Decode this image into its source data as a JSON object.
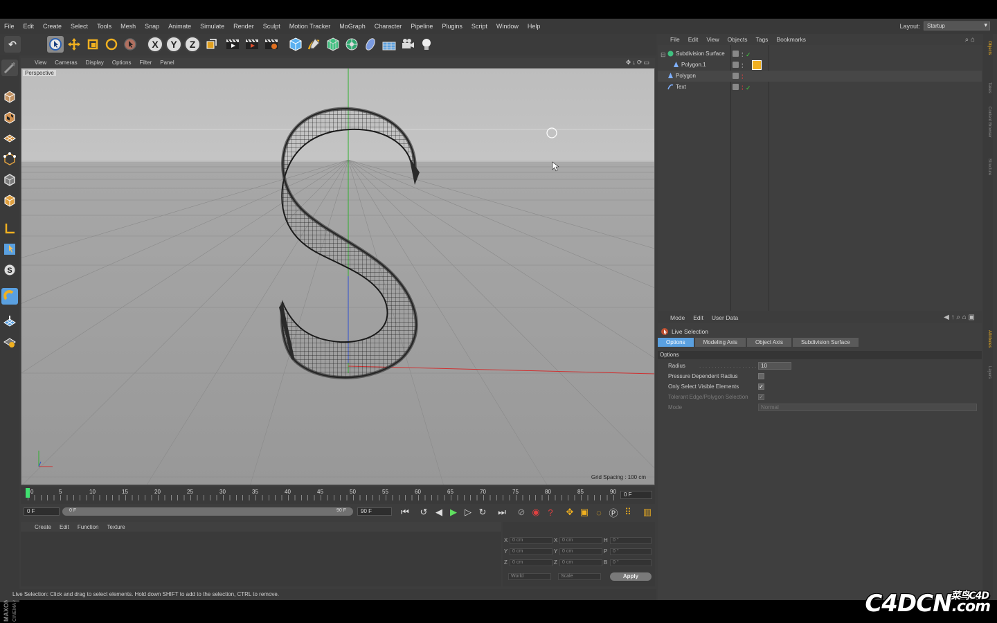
{
  "menubar": {
    "items": [
      "File",
      "Edit",
      "Create",
      "Select",
      "Tools",
      "Mesh",
      "Snap",
      "Animate",
      "Simulate",
      "Render",
      "Sculpt",
      "Motion Tracker",
      "MoGraph",
      "Character",
      "Pipeline",
      "Plugins",
      "Script",
      "Window",
      "Help"
    ],
    "layout_label": "Layout:",
    "layout_value": "Startup"
  },
  "toolbar": {
    "axis_x": "X",
    "axis_y": "Y",
    "axis_z": "Z"
  },
  "viewport": {
    "menu": [
      "View",
      "Cameras",
      "Display",
      "Options",
      "Filter",
      "Panel"
    ],
    "camera_label": "Perspective",
    "grid_info": "Grid Spacing : 100 cm",
    "nav_icons": "✥↓⟳▭"
  },
  "timeline": {
    "ticks": [
      "0",
      "5",
      "10",
      "15",
      "20",
      "25",
      "30",
      "35",
      "40",
      "45",
      "50",
      "55",
      "60",
      "65",
      "70",
      "75",
      "80",
      "85",
      "90"
    ],
    "current_frame_box": "0 F",
    "start_frame": "0 F",
    "range_start": "0 F",
    "range_end": "90 F",
    "end_frame": "90 F"
  },
  "material_manager": {
    "menu": [
      "Create",
      "Edit",
      "Function",
      "Texture"
    ]
  },
  "coordinates": {
    "rows": [
      {
        "a": "X",
        "av": "0 cm",
        "b": "X",
        "bv": "0 cm",
        "c": "H",
        "cv": "0 °"
      },
      {
        "a": "Y",
        "av": "0 cm",
        "b": "Y",
        "bv": "0 cm",
        "c": "P",
        "cv": "0 °"
      },
      {
        "a": "Z",
        "av": "0 cm",
        "b": "Z",
        "bv": "0 cm",
        "c": "B",
        "cv": "0 °"
      }
    ],
    "space_select": "World",
    "mode_select": "Scale",
    "apply_label": "Apply"
  },
  "status": {
    "text": "Live Selection: Click and drag to select elements. Hold down SHIFT to add to the selection, CTRL to remove."
  },
  "object_manager": {
    "menu": [
      "File",
      "Edit",
      "View",
      "Objects",
      "Tags",
      "Bookmarks"
    ],
    "objects": [
      {
        "name": "Subdivision Surface",
        "color": "#6ed06e"
      },
      {
        "name": "Polygon.1",
        "color": "#7fb0ff"
      },
      {
        "name": "Polygon",
        "color": "#7fb0ff"
      },
      {
        "name": "Text",
        "color": "#7fb0ff"
      }
    ]
  },
  "attribute_manager": {
    "menu": [
      "Mode",
      "Edit",
      "User Data"
    ],
    "tool_name": "Live Selection",
    "tabs": [
      "Options",
      "Modeling Axis",
      "Object Axis",
      "Subdivision Surface"
    ],
    "section": "Options",
    "props": [
      {
        "label": "Radius",
        "value": "10"
      },
      {
        "label": "Pressure Dependent Radius",
        "value": ""
      },
      {
        "label": "Only Select Visible Elements",
        "value": "✓"
      },
      {
        "label": "Tolerant Edge/Polygon Selection",
        "value": "✓"
      },
      {
        "label": "Mode",
        "value": "Normal"
      }
    ]
  },
  "side_tabs": [
    "Objects",
    "Takes",
    "Content Browser",
    "Structure",
    "Attributes",
    "Layers"
  ],
  "branding": {
    "maxon": "MAXON",
    "cinema": "CINEMA 4D",
    "watermark": "C4DCN",
    "watermark_suffix": ".com",
    "watermark_cn": "菜鸟C4D"
  },
  "colors": {
    "accent": "#5aa0e0",
    "panel": "#3f3f3f",
    "x_axis": "#d03030",
    "y_axis": "#30b030"
  }
}
